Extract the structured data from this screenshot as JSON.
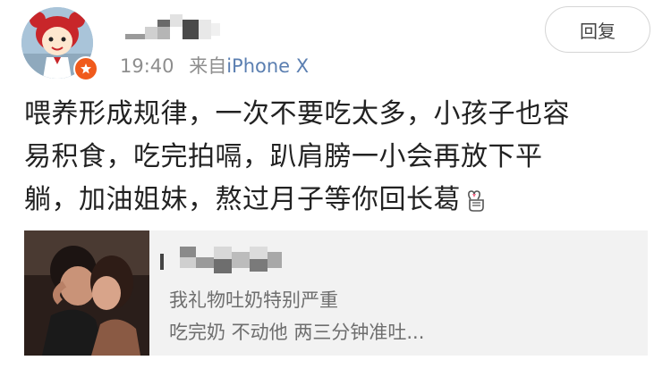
{
  "post": {
    "time": "19:40",
    "source_prefix": "来自",
    "source_device": "iPhone X",
    "reply_label": "回复",
    "body_lines": [
      "喂养形成规律，一次不要吃太多，小孩子也容",
      "易积食，吃完拍嗝，趴肩膀一小会再放下平",
      "躺，加油姐妹，熬过月子等你回长葛"
    ],
    "emoji_icon": "finger-heart-icon",
    "author_name_hidden": "pixelated-name-icon",
    "avatar_icon": "cartoon-girl-avatar-icon",
    "badge_icon": "vip-star-badge-icon"
  },
  "quote": {
    "name_hidden": "pixelated-name-icon",
    "thumbnail_icon": "couple-photo-thumbnail",
    "line1": "我礼物吐奶特别严重",
    "line2": "吃完奶 不动他 两三分钟准吐..."
  },
  "colors": {
    "link": "#5b7fb1",
    "meta": "#8e8e8e",
    "badge": "#f05a1c",
    "quote_bg": "#f2f2f2"
  }
}
